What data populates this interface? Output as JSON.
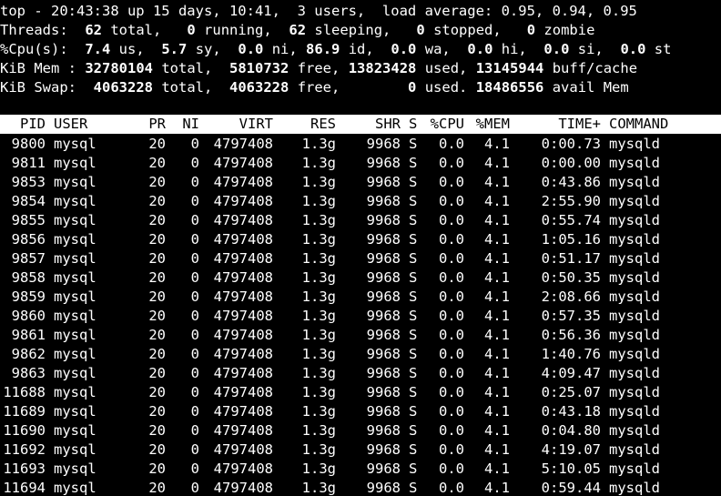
{
  "summary": {
    "line1": "top - 20:43:38 up 15 days, 10:41,  3 users,  load average: 0.95, 0.94, 0.95",
    "threads": {
      "label": "Threads:",
      "total": "62",
      "total_label": "total,",
      "running": "0",
      "running_label": "running,",
      "sleeping": "62",
      "sleeping_label": "sleeping,",
      "stopped": "0",
      "stopped_label": "stopped,",
      "zombie": "0",
      "zombie_label": "zombie"
    },
    "cpu": {
      "label": "%Cpu(s):",
      "us": "7.4",
      "us_label": "us,",
      "sy": "5.7",
      "sy_label": "sy,",
      "ni": "0.0",
      "ni_label": "ni,",
      "id": "86.9",
      "id_label": "id,",
      "wa": "0.0",
      "wa_label": "wa,",
      "hi": "0.0",
      "hi_label": "hi,",
      "si": "0.0",
      "si_label": "si,",
      "st": "0.0",
      "st_label": "st"
    },
    "mem": {
      "label": "KiB Mem :",
      "total": "32780104",
      "total_label": "total,",
      "free": "5810732",
      "free_label": "free,",
      "used": "13823428",
      "used_label": "used,",
      "buff": "13145944",
      "buff_label": "buff/cache"
    },
    "swap": {
      "label": "KiB Swap:",
      "total": "4063228",
      "total_label": "total,",
      "free": "4063228",
      "free_label": "free,",
      "used": "0",
      "used_label": "used.",
      "avail": "18486556",
      "avail_label": "avail Mem"
    }
  },
  "columns": [
    "PID",
    "USER",
    "PR",
    "NI",
    "VIRT",
    "RES",
    "SHR",
    "S",
    "%CPU",
    "%MEM",
    "TIME+",
    "COMMAND"
  ],
  "processes": [
    [
      "9800",
      "mysql",
      "20",
      "0",
      "4797408",
      "1.3g",
      "9968",
      "S",
      "0.0",
      "4.1",
      "0:00.73",
      "mysqld"
    ],
    [
      "9811",
      "mysql",
      "20",
      "0",
      "4797408",
      "1.3g",
      "9968",
      "S",
      "0.0",
      "4.1",
      "0:00.00",
      "mysqld"
    ],
    [
      "9853",
      "mysql",
      "20",
      "0",
      "4797408",
      "1.3g",
      "9968",
      "S",
      "0.0",
      "4.1",
      "0:43.86",
      "mysqld"
    ],
    [
      "9854",
      "mysql",
      "20",
      "0",
      "4797408",
      "1.3g",
      "9968",
      "S",
      "0.0",
      "4.1",
      "2:55.90",
      "mysqld"
    ],
    [
      "9855",
      "mysql",
      "20",
      "0",
      "4797408",
      "1.3g",
      "9968",
      "S",
      "0.0",
      "4.1",
      "0:55.74",
      "mysqld"
    ],
    [
      "9856",
      "mysql",
      "20",
      "0",
      "4797408",
      "1.3g",
      "9968",
      "S",
      "0.0",
      "4.1",
      "1:05.16",
      "mysqld"
    ],
    [
      "9857",
      "mysql",
      "20",
      "0",
      "4797408",
      "1.3g",
      "9968",
      "S",
      "0.0",
      "4.1",
      "0:51.17",
      "mysqld"
    ],
    [
      "9858",
      "mysql",
      "20",
      "0",
      "4797408",
      "1.3g",
      "9968",
      "S",
      "0.0",
      "4.1",
      "0:50.35",
      "mysqld"
    ],
    [
      "9859",
      "mysql",
      "20",
      "0",
      "4797408",
      "1.3g",
      "9968",
      "S",
      "0.0",
      "4.1",
      "2:08.66",
      "mysqld"
    ],
    [
      "9860",
      "mysql",
      "20",
      "0",
      "4797408",
      "1.3g",
      "9968",
      "S",
      "0.0",
      "4.1",
      "0:57.35",
      "mysqld"
    ],
    [
      "9861",
      "mysql",
      "20",
      "0",
      "4797408",
      "1.3g",
      "9968",
      "S",
      "0.0",
      "4.1",
      "0:56.36",
      "mysqld"
    ],
    [
      "9862",
      "mysql",
      "20",
      "0",
      "4797408",
      "1.3g",
      "9968",
      "S",
      "0.0",
      "4.1",
      "1:40.76",
      "mysqld"
    ],
    [
      "9863",
      "mysql",
      "20",
      "0",
      "4797408",
      "1.3g",
      "9968",
      "S",
      "0.0",
      "4.1",
      "4:09.47",
      "mysqld"
    ],
    [
      "11688",
      "mysql",
      "20",
      "0",
      "4797408",
      "1.3g",
      "9968",
      "S",
      "0.0",
      "4.1",
      "0:25.07",
      "mysqld"
    ],
    [
      "11689",
      "mysql",
      "20",
      "0",
      "4797408",
      "1.3g",
      "9968",
      "S",
      "0.0",
      "4.1",
      "0:43.18",
      "mysqld"
    ],
    [
      "11690",
      "mysql",
      "20",
      "0",
      "4797408",
      "1.3g",
      "9968",
      "S",
      "0.0",
      "4.1",
      "0:04.80",
      "mysqld"
    ],
    [
      "11692",
      "mysql",
      "20",
      "0",
      "4797408",
      "1.3g",
      "9968",
      "S",
      "0.0",
      "4.1",
      "4:19.07",
      "mysqld"
    ],
    [
      "11693",
      "mysql",
      "20",
      "0",
      "4797408",
      "1.3g",
      "9968",
      "S",
      "0.0",
      "4.1",
      "5:10.05",
      "mysqld"
    ],
    [
      "11694",
      "mysql",
      "20",
      "0",
      "4797408",
      "1.3g",
      "9968",
      "S",
      "0.0",
      "4.1",
      "0:59.44",
      "mysqld"
    ]
  ]
}
